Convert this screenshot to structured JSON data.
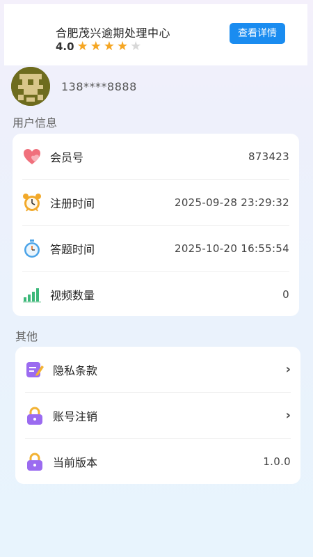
{
  "ad": {
    "title": "合肥茂兴逾期处理中心",
    "rating": "4.0",
    "stars_filled": 4,
    "stars_total": 5,
    "button_label": "查看详情"
  },
  "profile": {
    "phone": "138****8888"
  },
  "user_info": {
    "section_title": "用户信息",
    "items": [
      {
        "label": "会员号",
        "value": "873423",
        "icon": "heart-icon"
      },
      {
        "label": "注册时间",
        "value": "2025-09-28 23:29:32",
        "icon": "alarm-clock-icon"
      },
      {
        "label": "答题时间",
        "value": "2025-10-20 16:55:54",
        "icon": "stopwatch-icon"
      },
      {
        "label": "视频数量",
        "value": "0",
        "icon": "bar-chart-icon"
      }
    ]
  },
  "other": {
    "section_title": "其他",
    "items": [
      {
        "label": "隐私条款",
        "icon": "document-edit-icon",
        "chevron": "›"
      },
      {
        "label": "账号注销",
        "icon": "lock-icon",
        "chevron": "›"
      },
      {
        "label": "当前版本",
        "value": "1.0.0",
        "icon": "lock-icon"
      }
    ]
  },
  "colors": {
    "accent": "#1a8cf0",
    "star": "#f5a623",
    "lock": "#9b6bf0"
  }
}
